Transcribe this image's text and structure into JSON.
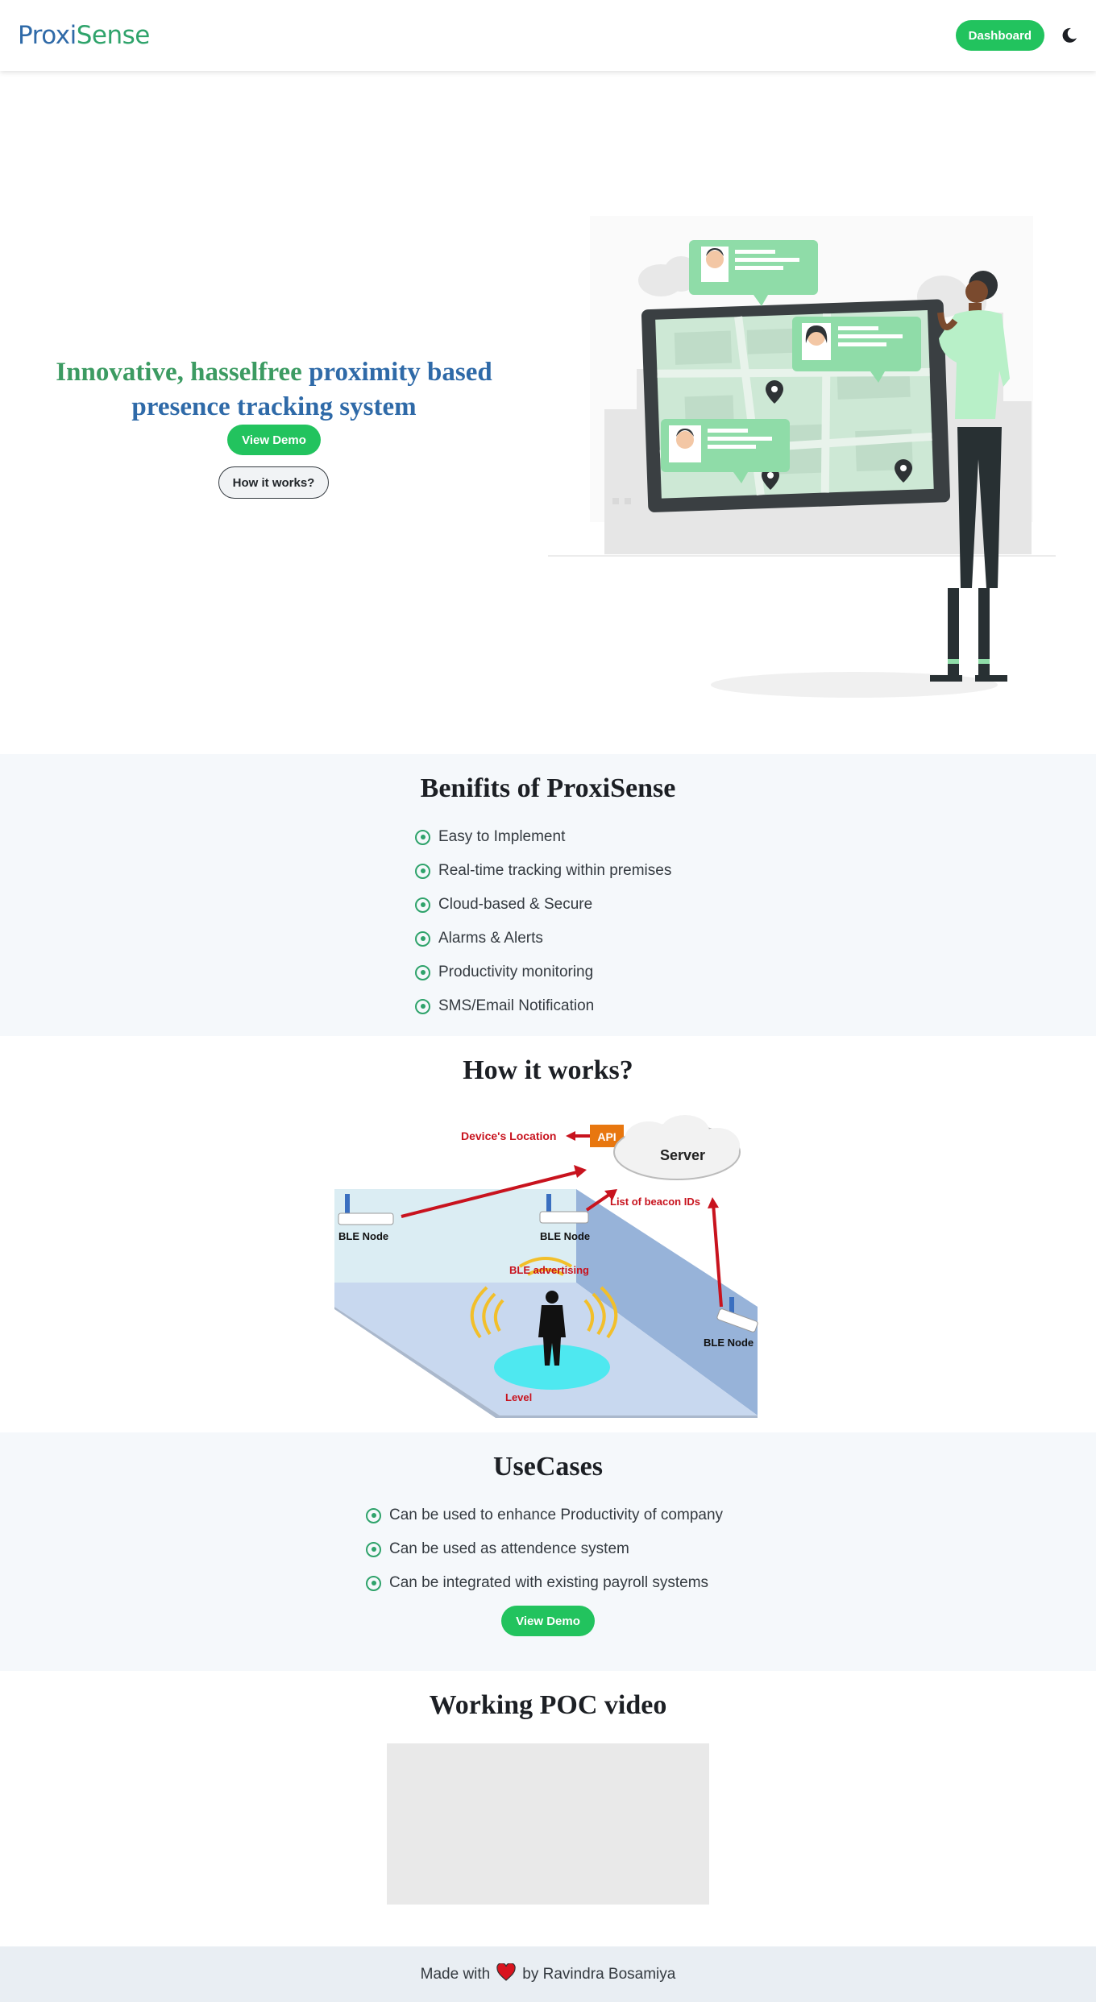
{
  "navbar": {
    "brand_part1": "Proxi",
    "brand_part2": "Sense",
    "dashboard_label": "Dashboard",
    "theme_icon": "moon-icon"
  },
  "hero": {
    "title_green": "Innovative, hasselfree",
    "title_blue": "proximity based presence tracking system",
    "view_demo_label": "View Demo",
    "how_it_works_label": "How it works?"
  },
  "benefits": {
    "title": "Benifits of ProxiSense",
    "items": [
      "Easy to Implement",
      "Real-time tracking within premises",
      "Cloud-based & Secure",
      "Alarms & Alerts",
      "Productivity monitoring",
      "SMS/Email Notification"
    ]
  },
  "how": {
    "title": "How it works?",
    "diagram": {
      "devices_location": "Device's Location",
      "api": "API",
      "server": "Server",
      "list_of_beacon_ids": "List of beacon IDs",
      "ble_node": "BLE Node",
      "ble_advertising": "BLE advertising",
      "level": "Level"
    }
  },
  "usecases": {
    "title": "UseCases",
    "items": [
      "Can be used to enhance Productivity of company",
      "Can be used as attendence system",
      "Can be integrated with existing payroll systems"
    ],
    "view_demo_label": "View Demo"
  },
  "poc": {
    "title": "Working POC video"
  },
  "footer": {
    "made_with": "Made with",
    "by": "by Ravindra Bosamiya",
    "heart_icon": "heart-icon"
  },
  "colors": {
    "brand_blue": "#2f6aa8",
    "brand_green": "#2fa36b",
    "button_green": "#22c35e",
    "section_bg": "#f5f8fb",
    "footer_bg": "#e9eef3"
  }
}
